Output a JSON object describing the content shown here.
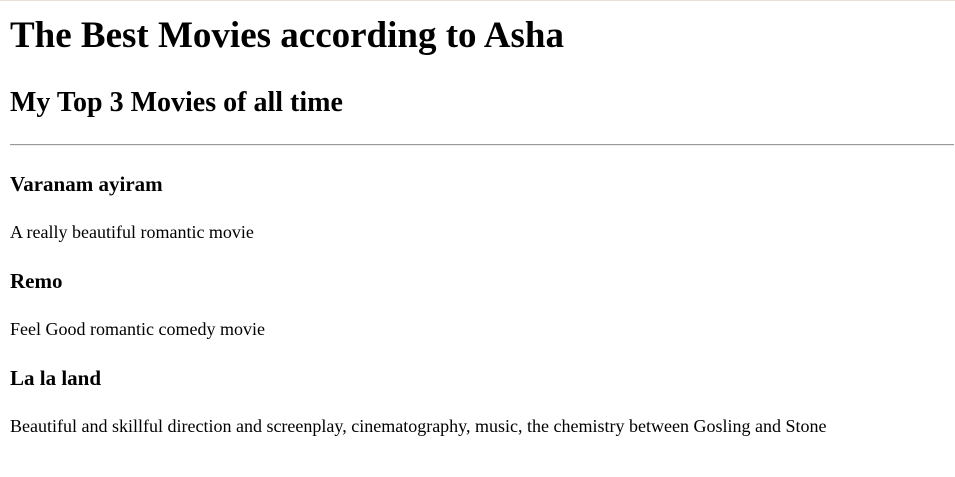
{
  "page": {
    "title": "The Best Movies according to Asha",
    "subtitle": "My Top 3 Movies of all time"
  },
  "movies": [
    {
      "title": "Varanam ayiram",
      "description": "A really beautiful romantic movie"
    },
    {
      "title": "Remo",
      "description": "Feel Good romantic comedy movie"
    },
    {
      "title": "La la land",
      "description": "Beautiful and skillful direction and screenplay, cinematography, music, the chemistry between Gosling and Stone"
    }
  ]
}
